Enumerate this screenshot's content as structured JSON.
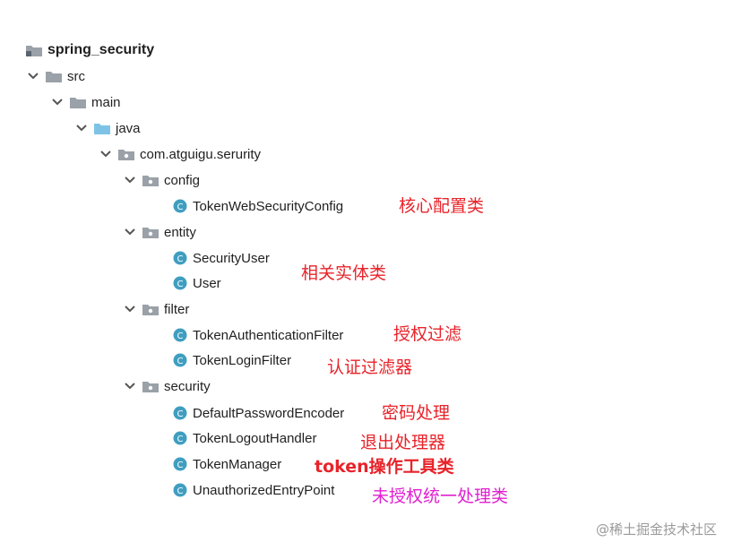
{
  "tree": {
    "root": "spring_security",
    "src": "src",
    "main": "main",
    "java": "java",
    "package": "com.atguigu.serurity",
    "config": {
      "label": "config",
      "classes": [
        "TokenWebSecurityConfig"
      ]
    },
    "entity": {
      "label": "entity",
      "classes": [
        "SecurityUser",
        "User"
      ]
    },
    "filter": {
      "label": "filter",
      "classes": [
        "TokenAuthenticationFilter",
        "TokenLoginFilter"
      ]
    },
    "security": {
      "label": "security",
      "classes": [
        "DefaultPasswordEncoder",
        "TokenLogoutHandler",
        "TokenManager",
        "UnauthorizedEntryPoint"
      ]
    }
  },
  "annotations": {
    "config": "核心配置类",
    "entity": "相关实体类",
    "auth_filter": "授权过滤",
    "login_filter": "认证过滤器",
    "password": "密码处理",
    "logout": "退出处理器",
    "token_manager": "token操作工具类",
    "unauthorized": "未授权统一处理类"
  },
  "watermark": "@稀土掘金技术社区",
  "colors": {
    "annotation_red": "#e8232a",
    "annotation_magenta": "#e020d0",
    "folder_gray": "#9aa1a8",
    "source_folder_blue": "#7ec3e6",
    "class_icon_teal": "#3f9ec0"
  }
}
